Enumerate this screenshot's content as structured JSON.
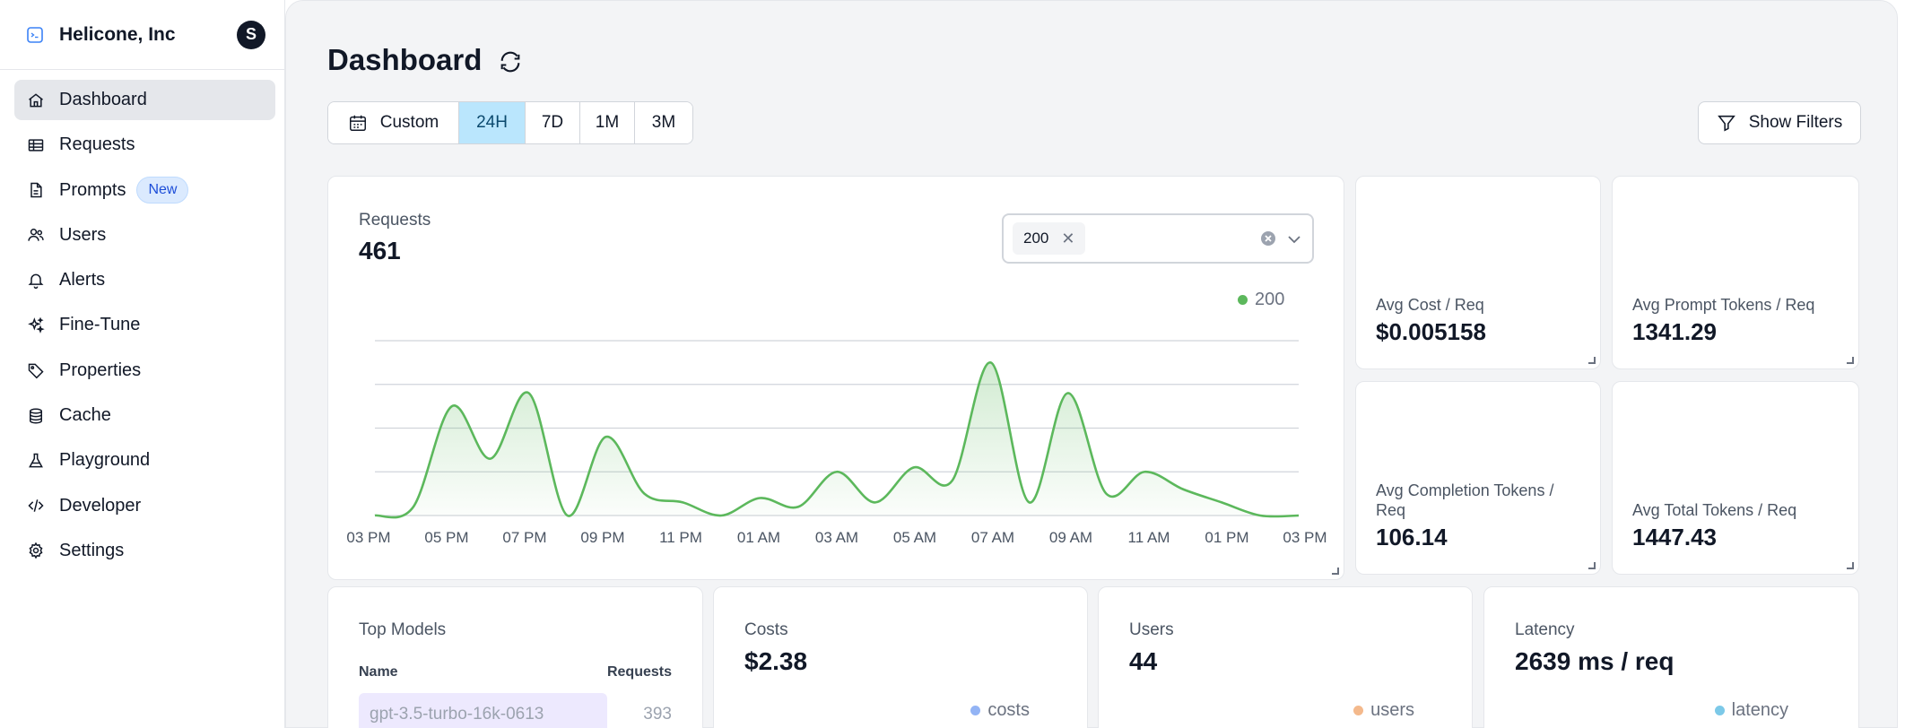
{
  "org": {
    "name": "Helicone, Inc",
    "avatar_initial": "S"
  },
  "sidebar": {
    "items": [
      {
        "label": "Dashboard",
        "icon": "home-icon",
        "active": true
      },
      {
        "label": "Requests",
        "icon": "table-icon"
      },
      {
        "label": "Prompts",
        "icon": "document-icon",
        "badge": "New"
      },
      {
        "label": "Users",
        "icon": "users-icon"
      },
      {
        "label": "Alerts",
        "icon": "bell-icon"
      },
      {
        "label": "Fine-Tune",
        "icon": "sparkles-icon"
      },
      {
        "label": "Properties",
        "icon": "tag-icon"
      },
      {
        "label": "Cache",
        "icon": "database-icon"
      },
      {
        "label": "Playground",
        "icon": "beaker-icon"
      },
      {
        "label": "Developer",
        "icon": "code-icon"
      },
      {
        "label": "Settings",
        "icon": "gear-icon"
      }
    ]
  },
  "header": {
    "title": "Dashboard"
  },
  "time_range": {
    "custom_label": "Custom",
    "options": [
      "24H",
      "7D",
      "1M",
      "3M"
    ],
    "selected": "24H"
  },
  "filters_button": "Show Filters",
  "requests_card": {
    "label": "Requests",
    "value": "461",
    "status_filter_chip": "200",
    "legend_label": "200",
    "series_color": "#5cb85c"
  },
  "chart_data": {
    "type": "area",
    "title": "",
    "x": [
      "03 PM",
      "05 PM",
      "07 PM",
      "09 PM",
      "11 PM",
      "01 AM",
      "03 AM",
      "05 AM",
      "07 AM",
      "09 AM",
      "11 AM",
      "01 PM",
      "03 PM"
    ],
    "series": [
      {
        "name": "200",
        "values": [
          0,
          2,
          25,
          13,
          28,
          0,
          18,
          5,
          3,
          0,
          4,
          2,
          10,
          3,
          11,
          8,
          35,
          3,
          28,
          5,
          10,
          6,
          3,
          0,
          0
        ]
      }
    ],
    "ylim": [
      0,
      40
    ],
    "grid": true,
    "legend_position": "top-right"
  },
  "stats": [
    {
      "label": "Avg Cost / Req",
      "value": "$0.005158"
    },
    {
      "label": "Avg Prompt Tokens / Req",
      "value": "1341.29"
    },
    {
      "label": "Avg Completion Tokens / Req",
      "value": "106.14"
    },
    {
      "label": "Avg Total Tokens / Req",
      "value": "1447.43"
    }
  ],
  "top_models": {
    "label": "Top Models",
    "col_name": "Name",
    "col_requests": "Requests",
    "rows": [
      {
        "name": "gpt-3.5-turbo-16k-0613",
        "requests": "393"
      }
    ]
  },
  "costs": {
    "label": "Costs",
    "value": "$2.38",
    "legend": "costs",
    "color": "#93b4f5"
  },
  "users": {
    "label": "Users",
    "value": "44",
    "legend": "users",
    "color": "#f4b98c"
  },
  "latency": {
    "label": "Latency",
    "value": "2639 ms / req",
    "legend": "latency",
    "color": "#7cc9e8"
  }
}
